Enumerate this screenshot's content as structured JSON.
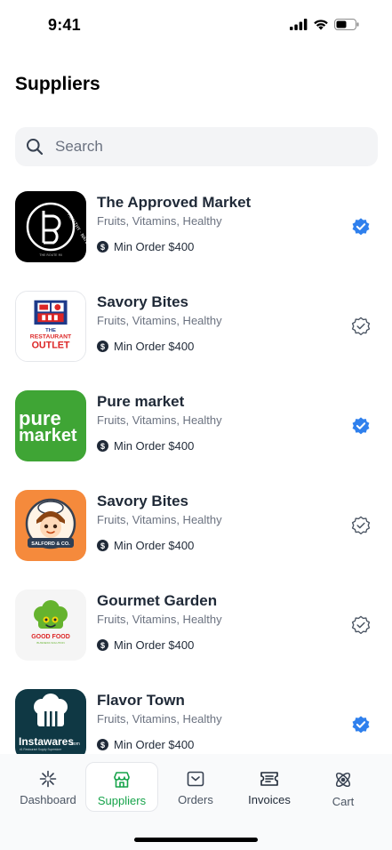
{
  "status": {
    "time": "9:41"
  },
  "title": "Suppliers",
  "search": {
    "placeholder": "Search",
    "value": ""
  },
  "suppliers": [
    {
      "name": "The Approved Market",
      "tags": "Fruits, Vitamins, Healthy",
      "min_order": "Min Order $400",
      "verified": true,
      "logo": {
        "name": "approved-market-logo",
        "ring_text": "HEALTHY · NATURAL · POWER",
        "sub_text": "THE ROUTE MI"
      }
    },
    {
      "name": "Savory Bites",
      "tags": "Fruits, Vitamins, Healthy",
      "min_order": "Min Order $400",
      "verified": false,
      "logo": {
        "name": "restaurant-outlet-logo",
        "line1": "THE",
        "line2": "RESTAURANT",
        "line3": "OUTLET"
      }
    },
    {
      "name": "Pure market",
      "tags": "Fruits, Vitamins, Healthy",
      "min_order": "Min Order $400",
      "verified": true,
      "logo": {
        "name": "pure-market-logo",
        "line1": "pure",
        "line2": "market"
      }
    },
    {
      "name": "Savory Bites",
      "tags": "Fruits, Vitamins, Healthy",
      "min_order": "Min Order $400",
      "verified": false,
      "logo": {
        "name": "salford-co-logo",
        "banner": "SALFORD & CO."
      }
    },
    {
      "name": "Gourmet Garden",
      "tags": "Fruits, Vitamins, Healthy",
      "min_order": "Min Order $400",
      "verified": false,
      "logo": {
        "name": "good-food-logo",
        "line1": "GOOD FOOD",
        "line2": "BUSINESS SOLUTION"
      }
    },
    {
      "name": "Flavor Town",
      "tags": "Fruits, Vitamins, Healthy",
      "min_order": "Min Order $400",
      "verified": true,
      "logo": {
        "name": "instawares-logo",
        "line1": "Instawares",
        "line1_suffix": ".com",
        "line2": "#1 Restaurant Supply Superstore"
      }
    }
  ],
  "tabs": [
    {
      "label": "Dashboard",
      "icon": "sparkle-icon",
      "active": false
    },
    {
      "label": "Suppliers",
      "icon": "store-icon",
      "active": true
    },
    {
      "label": "Orders",
      "icon": "inbox-icon",
      "active": false
    },
    {
      "label": "Invoices",
      "icon": "receipt-icon",
      "active": false
    },
    {
      "label": "Cart",
      "icon": "atom-icon",
      "active": false
    }
  ],
  "colors": {
    "accent_green": "#16a34a",
    "verified_blue": "#2f80ed",
    "text_dark": "#1f2937",
    "text_muted": "#6b7280"
  }
}
